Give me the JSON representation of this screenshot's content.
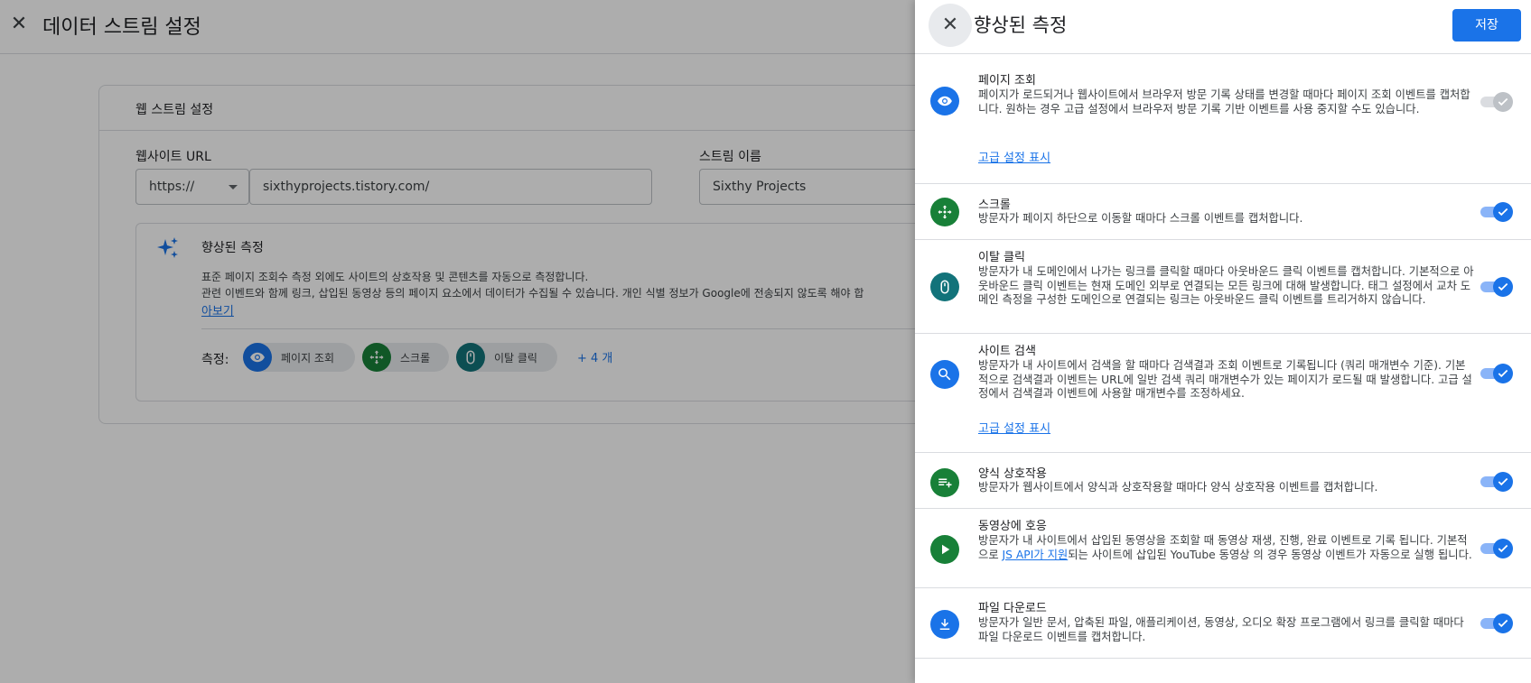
{
  "background": {
    "title": "데이터 스트림 설정",
    "card_title": "웹 스트림 설정",
    "website_url_label": "웹사이트 URL",
    "protocol_value": "https://",
    "url_value": "sixthyprojects.tistory.com/",
    "stream_name_label": "스트림 이름",
    "stream_name_value": "Sixthy Projects",
    "enhanced": {
      "title": "향상된 측정",
      "desc_line1": "표준 페이지 조회수 측정 외에도 사이트의 상호작용 및 콘텐츠를 자동으로 측정합니다.",
      "desc_line2": "관련 이벤트와 함께 링크, 삽입된 동영상 등의 페이지 요소에서 데이터가 수집될 수 있습니다. 개인 식별 정보가 Google에 전송되지 않도록 해야 합",
      "learn_more": "아보기",
      "measure_label": "측정:",
      "chips": [
        "페이지 조회",
        "스크롤",
        "이탈 클릭"
      ],
      "more_label": "+ 4 개"
    }
  },
  "panel": {
    "title": "향상된 측정",
    "save_label": "저장",
    "items": [
      {
        "title": "페이지 조회",
        "desc": "페이지가 로드되거나 웹사이트에서 브라우저 방문 기록 상태를 변경할 때마다 페이지 조회 이벤트를 캡처합니다. 원하는 경우 고급 설정에서 브라우저 방문 기록 기반 이벤트를 사용 중지할 수도 있습니다.",
        "advanced_link": "고급 설정 표시",
        "enabled": true,
        "locked": true
      },
      {
        "title": "스크롤",
        "desc": "방문자가 페이지 하단으로 이동할 때마다 스크롤 이벤트를 캡처합니다.",
        "enabled": true
      },
      {
        "title": "이탈 클릭",
        "desc": "방문자가 내 도메인에서 나가는 링크를 클릭할 때마다 아웃바운드 클릭 이벤트를 캡처합니다. 기본적으로 아웃바운드 클릭 이벤트는 현재 도메인 외부로 연결되는 모든 링크에 대해 발생합니다. 태그 설정에서 교차 도메인 측정을 구성한 도메인으로 연결되는 링크는 아웃바운드 클릭 이벤트를 트리거하지 않습니다.",
        "enabled": true
      },
      {
        "title": "사이트 검색",
        "desc": "방문자가 내 사이트에서 검색을 할 때마다 검색결과 조회 이벤트로 기록됩니다 (쿼리 매개변수 기준). 기본적으로 검색결과 이벤트는 URL에 일반 검색 쿼리 매개변수가 있는 페이지가 로드될 때 발생합니다. 고급 설정에서 검색결과 이벤트에 사용할 매개변수를 조정하세요.",
        "advanced_link": "고급 설정 표시",
        "enabled": true
      },
      {
        "title": "양식 상호작용",
        "desc": "방문자가 웹사이트에서 양식과 상호작용할 때마다 양식 상호작용 이벤트를 캡처합니다.",
        "enabled": true
      },
      {
        "title": "동영상에 호응",
        "desc_pre": "방문자가 내 사이트에서 삽입된 동영상을 조회할 때 동영상 재생, 진행, 완료 이벤트로 기록 됩니다. 기본적으로 ",
        "desc_link": "JS API가 지원",
        "desc_post": "되는 사이트에 삽입된 YouTube 동영상 의 경우 동영상 이벤트가 자동으로 실행 됩니다.",
        "enabled": true
      },
      {
        "title": "파일 다운로드",
        "desc": "방문자가 일반 문서, 압축된 파일, 애플리케이션, 동영상, 오디오 확장 프로그램에서 링크를 클릭할 때마다 파일 다운로드 이벤트를 캡처합니다.",
        "enabled": true
      }
    ]
  },
  "icons": [
    "eye-icon",
    "scroll-icon",
    "mouse-icon",
    "search-icon",
    "form-icon",
    "play-icon",
    "download-icon"
  ],
  "colors": {
    "primary": "#1a73e8",
    "green": "#188038",
    "teal": "#12737a"
  }
}
